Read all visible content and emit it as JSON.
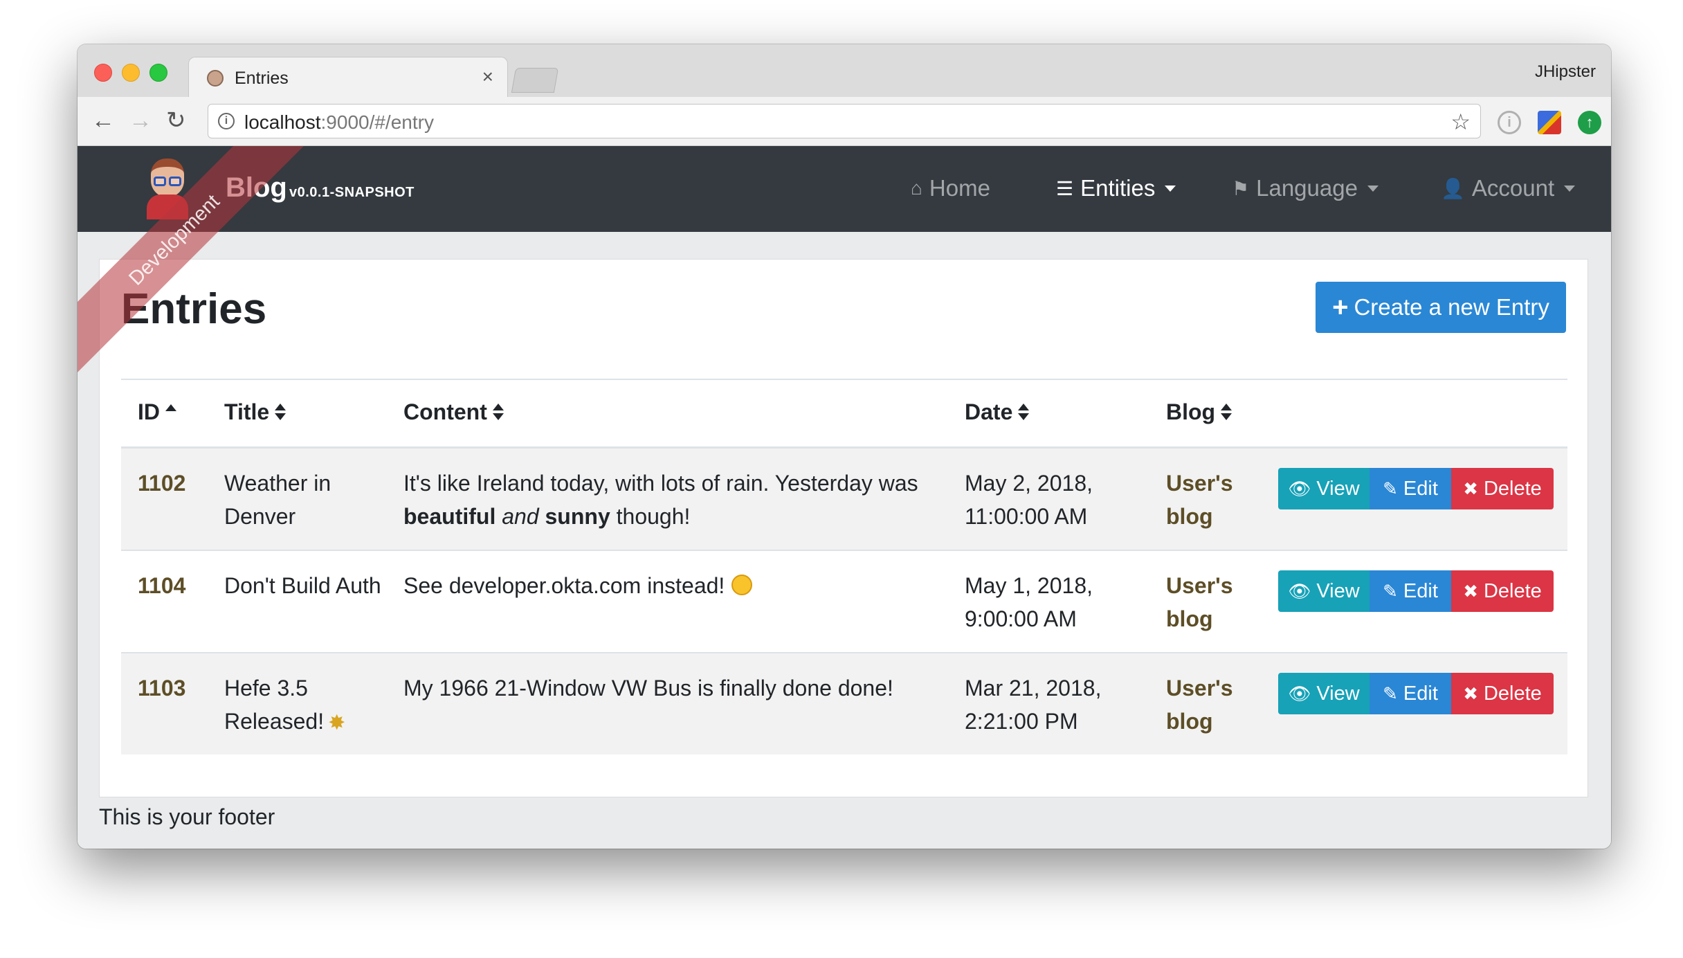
{
  "browser": {
    "tab_title": "Entries",
    "tab_close": "×",
    "profile_name": "JHipster",
    "url_host": "localhost",
    "url_rest": ":9000/#/entry"
  },
  "navbar": {
    "brand": "Blog",
    "version": "v0.0.1-SNAPSHOT",
    "ribbon": "Development",
    "menu": [
      {
        "label": "Home",
        "icon": "home-icon"
      },
      {
        "label": "Entities",
        "icon": "list-icon"
      },
      {
        "label": "Language",
        "icon": "flag-icon"
      },
      {
        "label": "Account",
        "icon": "user-icon"
      }
    ]
  },
  "page": {
    "title": "Entries",
    "create_button": "Create a new Entry",
    "footer": "This is your footer"
  },
  "table": {
    "headers": [
      "ID",
      "Title",
      "Content",
      "Date",
      "Blog"
    ],
    "sort": [
      "asc",
      "both",
      "both",
      "both",
      "both"
    ],
    "rows": [
      {
        "id": "1102",
        "title": "Weather in Denver",
        "content_parts": [
          "It's like Ireland today, with lots of rain. Yesterday was ",
          "beautiful",
          " ",
          "and",
          " ",
          "sunny",
          " though!"
        ],
        "date": "May 2, 2018, 11:00:00 AM",
        "blog": "User's blog"
      },
      {
        "id": "1104",
        "title": "Don't Build Auth",
        "content": "See developer.okta.com instead!",
        "emoji": "smiling-face-icon",
        "date": "May 1, 2018, 9:00:00 AM",
        "blog": "User's blog"
      },
      {
        "id": "1103",
        "title": "Hefe 3.5 Released!",
        "emoji": "party-popper-icon",
        "content": "My 1966 21-Window VW Bus is finally done done!",
        "date": "Mar 21, 2018, 2:21:00 PM",
        "blog": "User's blog"
      }
    ],
    "actions": {
      "view": "View",
      "edit": "Edit",
      "delete": "Delete"
    }
  },
  "colors": {
    "navbar": "#343a40",
    "primary": "#2a87d5",
    "info": "#17a2b8",
    "danger": "#dc3545",
    "link": "#5d4e27"
  }
}
